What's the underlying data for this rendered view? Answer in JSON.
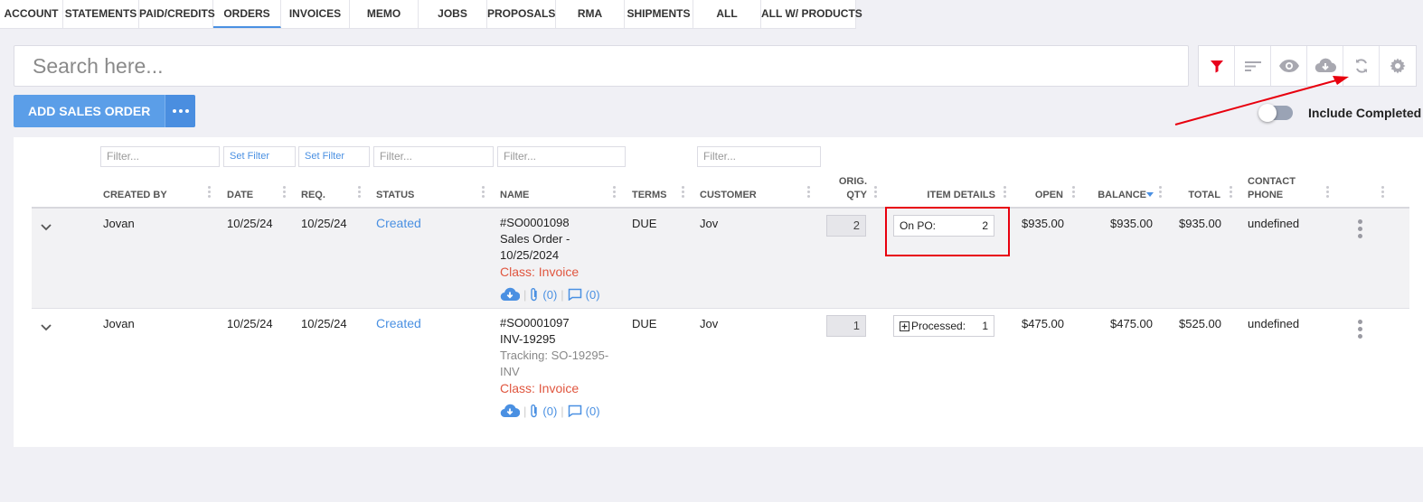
{
  "tabs": [
    {
      "label": "ACCOUNT",
      "active": false
    },
    {
      "label": "STATEMENTS",
      "active": false
    },
    {
      "label": "PAID/CREDITS",
      "active": false
    },
    {
      "label": "ORDERS",
      "active": true
    },
    {
      "label": "INVOICES",
      "active": false
    },
    {
      "label": "MEMO",
      "active": false
    },
    {
      "label": "JOBS",
      "active": false
    },
    {
      "label": "PROPOSALS",
      "active": false
    },
    {
      "label": "RMA",
      "active": false
    },
    {
      "label": "SHIPMENTS",
      "active": false
    },
    {
      "label": "ALL",
      "active": false
    },
    {
      "label": "ALL W/ PRODUCTS",
      "active": false
    }
  ],
  "search": {
    "placeholder": "Search here..."
  },
  "toolbar": {
    "icons": [
      "filter-icon",
      "sort-icon",
      "eye-icon",
      "cloud-download-icon",
      "refresh-icon",
      "gear-icon"
    ],
    "filter_color": "#e8001c"
  },
  "add_button": {
    "label": "ADD SALES ORDER"
  },
  "include_completed": {
    "label": "Include Completed",
    "checked": false
  },
  "filters": {
    "created_by": "Filter...",
    "date": "Set Filter",
    "req": "Set Filter",
    "status": "Filter...",
    "name": "Filter...",
    "customer": "Filter..."
  },
  "columns": {
    "created_by": "CREATED BY",
    "date": "DATE",
    "req": "REQ.",
    "status": "STATUS",
    "name": "NAME",
    "terms": "TERMS",
    "customer": "CUSTOMER",
    "orig_qty_1": "ORIG.",
    "orig_qty_2": "QTY",
    "item_details": "ITEM DETAILS",
    "open": "OPEN",
    "balance": "BALANCE",
    "total": "TOTAL",
    "contact_1": "CONTACT",
    "contact_2": "PHONE"
  },
  "rows": [
    {
      "created_by": "Jovan",
      "date": "10/25/24",
      "req": "10/25/24",
      "status": "Created",
      "name_lines": [
        "#SO0001098",
        "Sales Order -",
        "10/25/2024"
      ],
      "class": "Class: Invoice",
      "attachments": "(0)",
      "comments": "(0)",
      "terms": "DUE",
      "customer": "Jov",
      "orig_qty": "2",
      "item_label": "On PO:",
      "item_value": "2",
      "open": "$935.00",
      "balance": "$935.00",
      "total": "$935.00",
      "contact_phone": "undefined"
    },
    {
      "created_by": "Jovan",
      "date": "10/25/24",
      "req": "10/25/24",
      "status": "Created",
      "name_lines": [
        "#SO0001097",
        "INV-19295"
      ],
      "tracking_lines": [
        "Tracking: SO-19295-",
        "INV"
      ],
      "class": "Class: Invoice",
      "attachments": "(0)",
      "comments": "(0)",
      "terms": "DUE",
      "customer": "Jov",
      "orig_qty": "1",
      "item_label": "Processed:",
      "item_value": "1",
      "open": "$475.00",
      "balance": "$475.00",
      "total": "$525.00",
      "contact_phone": "undefined"
    }
  ],
  "colors": {
    "accent": "#4a90e2",
    "class_red": "#e0563f",
    "highlight_red": "#e8000e"
  }
}
